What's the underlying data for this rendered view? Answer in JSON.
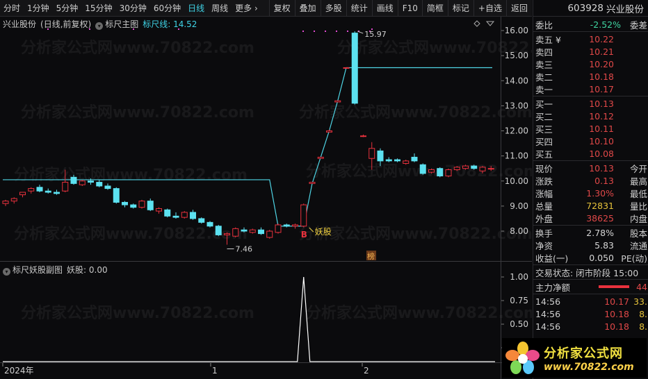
{
  "toolbar": {
    "periods": [
      "分时",
      "1分钟",
      "5分钟",
      "15分钟",
      "30分钟",
      "60分钟",
      "日线",
      "周线",
      "更多 ›"
    ],
    "active_period": "日线",
    "tools": [
      "复权",
      "叠加",
      "多股",
      "统计",
      "画线",
      "F10",
      "简框",
      "标记",
      "+自选",
      "返回"
    ]
  },
  "main_chart": {
    "stock_label": "兴业股份",
    "mode": "(日线,前复权)",
    "indicator_name": "标尺主图",
    "indicator_value_label": "标尺线: 14.52",
    "y_ticks": [
      "16.00",
      "15.00",
      "14.00",
      "13.00",
      "12.00",
      "11.00",
      "10.00",
      "9.00",
      "8.00"
    ],
    "high_label": "15.97",
    "low_label": "7.46",
    "buy_marker": "B",
    "signal_label": "妖股",
    "bang_label": "榜"
  },
  "sub_chart": {
    "indicator_name": "标尺妖股副图",
    "value_label": "妖股: 0.00",
    "y_ticks": [
      "1.00",
      "0.75",
      "0.50",
      "0.25"
    ]
  },
  "x_axis": {
    "labels": [
      "2024年",
      "1",
      "2"
    ]
  },
  "watermark_text": "分析家公式网www.70822.com",
  "chart_data": {
    "type": "candlestick",
    "ylim": [
      7.3,
      16.5
    ],
    "candles": [
      {
        "o": 9.1,
        "h": 9.25,
        "l": 9.0,
        "c": 9.2
      },
      {
        "o": 9.2,
        "h": 9.35,
        "l": 9.1,
        "c": 9.3
      },
      {
        "o": 9.45,
        "h": 9.55,
        "l": 9.35,
        "c": 9.55
      },
      {
        "o": 9.6,
        "h": 9.75,
        "l": 9.5,
        "c": 9.7
      },
      {
        "o": 9.75,
        "h": 9.85,
        "l": 9.55,
        "c": 9.6
      },
      {
        "o": 9.6,
        "h": 9.7,
        "l": 9.5,
        "c": 9.55
      },
      {
        "o": 9.55,
        "h": 9.65,
        "l": 9.45,
        "c": 9.5
      },
      {
        "o": 9.6,
        "h": 10.45,
        "l": 9.55,
        "c": 9.95
      },
      {
        "o": 10.15,
        "h": 10.25,
        "l": 9.85,
        "c": 9.9
      },
      {
        "o": 9.85,
        "h": 10.05,
        "l": 9.8,
        "c": 10.0
      },
      {
        "o": 10.0,
        "h": 10.1,
        "l": 9.85,
        "c": 9.95
      },
      {
        "o": 9.95,
        "h": 10.05,
        "l": 9.75,
        "c": 9.8
      },
      {
        "o": 9.8,
        "h": 9.9,
        "l": 9.65,
        "c": 9.7
      },
      {
        "o": 9.7,
        "h": 9.75,
        "l": 9.1,
        "c": 9.15
      },
      {
        "o": 9.15,
        "h": 9.2,
        "l": 8.95,
        "c": 9.05
      },
      {
        "o": 9.05,
        "h": 9.1,
        "l": 8.9,
        "c": 8.95
      },
      {
        "o": 8.95,
        "h": 9.25,
        "l": 8.9,
        "c": 9.2
      },
      {
        "o": 9.2,
        "h": 9.3,
        "l": 8.8,
        "c": 8.85
      },
      {
        "o": 8.8,
        "h": 8.95,
        "l": 8.7,
        "c": 8.9
      },
      {
        "o": 8.85,
        "h": 8.9,
        "l": 8.55,
        "c": 8.6
      },
      {
        "o": 8.6,
        "h": 8.75,
        "l": 8.5,
        "c": 8.55
      },
      {
        "o": 8.55,
        "h": 8.8,
        "l": 8.5,
        "c": 8.75
      },
      {
        "o": 8.75,
        "h": 8.85,
        "l": 8.45,
        "c": 8.5
      },
      {
        "o": 8.5,
        "h": 8.55,
        "l": 8.3,
        "c": 8.35
      },
      {
        "o": 8.35,
        "h": 8.4,
        "l": 8.15,
        "c": 8.2
      },
      {
        "o": 8.2,
        "h": 8.25,
        "l": 7.8,
        "c": 7.85
      },
      {
        "o": 7.85,
        "h": 7.95,
        "l": 7.46,
        "c": 7.9
      },
      {
        "o": 7.8,
        "h": 8.15,
        "l": 7.75,
        "c": 8.1
      },
      {
        "o": 8.05,
        "h": 8.15,
        "l": 7.95,
        "c": 8.0
      },
      {
        "o": 7.95,
        "h": 8.1,
        "l": 7.9,
        "c": 8.05
      },
      {
        "o": 8.05,
        "h": 8.15,
        "l": 7.85,
        "c": 7.9
      },
      {
        "o": 7.75,
        "h": 8.05,
        "l": 7.7,
        "c": 8.0
      },
      {
        "o": 7.95,
        "h": 8.3,
        "l": 7.9,
        "c": 8.25
      },
      {
        "o": 8.25,
        "h": 8.3,
        "l": 8.15,
        "c": 8.2
      },
      {
        "o": 8.2,
        "h": 8.3,
        "l": 8.1,
        "c": 8.25
      },
      {
        "o": 8.2,
        "h": 9.1,
        "l": 8.15,
        "c": 9.05
      },
      {
        "o": 9.9,
        "h": 9.95,
        "l": 9.9,
        "c": 9.95
      },
      {
        "o": 10.9,
        "h": 10.95,
        "l": 10.9,
        "c": 10.95
      },
      {
        "o": 11.95,
        "h": 12.05,
        "l": 11.95,
        "c": 12.0
      },
      {
        "o": 13.15,
        "h": 13.2,
        "l": 13.15,
        "c": 13.2
      },
      {
        "o": 14.5,
        "h": 14.52,
        "l": 14.5,
        "c": 14.52
      },
      {
        "o": 15.9,
        "h": 15.97,
        "l": 13.05,
        "c": 13.1
      },
      {
        "o": 11.8,
        "h": 11.85,
        "l": 11.75,
        "c": 11.8
      },
      {
        "o": 10.9,
        "h": 11.55,
        "l": 10.45,
        "c": 11.3
      },
      {
        "o": 11.2,
        "h": 11.3,
        "l": 10.6,
        "c": 10.8
      },
      {
        "o": 10.85,
        "h": 10.95,
        "l": 10.75,
        "c": 10.8
      },
      {
        "o": 10.85,
        "h": 10.9,
        "l": 10.75,
        "c": 10.8
      },
      {
        "o": 10.7,
        "h": 10.85,
        "l": 10.65,
        "c": 10.8
      },
      {
        "o": 10.95,
        "h": 11.1,
        "l": 10.75,
        "c": 10.8
      },
      {
        "o": 10.65,
        "h": 10.7,
        "l": 10.25,
        "c": 10.3
      },
      {
        "o": 10.35,
        "h": 10.5,
        "l": 10.3,
        "c": 10.45
      },
      {
        "o": 10.5,
        "h": 10.55,
        "l": 10.15,
        "c": 10.2
      },
      {
        "o": 10.2,
        "h": 10.5,
        "l": 10.15,
        "c": 10.45
      },
      {
        "o": 10.45,
        "h": 10.6,
        "l": 10.4,
        "c": 10.55
      },
      {
        "o": 10.5,
        "h": 10.65,
        "l": 10.45,
        "c": 10.6
      },
      {
        "o": 10.6,
        "h": 10.65,
        "l": 10.45,
        "c": 10.5
      },
      {
        "o": 10.4,
        "h": 10.6,
        "l": 10.3,
        "c": 10.55
      },
      {
        "o": 10.5,
        "h": 10.6,
        "l": 10.4,
        "c": 10.5
      }
    ],
    "ruler_line": [
      10.05,
      10.05,
      10.05,
      10.05,
      10.05,
      10.05,
      10.05,
      10.05,
      10.05,
      10.05,
      10.05,
      10.05,
      10.05,
      10.05,
      10.05,
      10.05,
      10.05,
      10.05,
      10.05,
      10.05,
      10.05,
      10.05,
      10.05,
      10.05,
      10.05,
      10.05,
      10.05,
      10.05,
      10.05,
      10.05,
      10.05,
      10.05,
      8.2,
      8.2,
      8.2,
      8.2,
      9.9,
      10.95,
      12.0,
      13.2,
      14.52,
      14.52,
      14.52,
      14.52,
      14.52,
      14.52,
      14.52,
      14.52,
      14.52,
      14.52,
      14.52,
      14.52,
      14.52,
      14.52,
      14.52,
      14.52,
      14.52,
      14.52
    ],
    "signal_series": [
      0,
      0,
      0,
      0,
      0,
      0,
      0,
      0,
      0,
      0,
      0,
      0,
      0,
      0,
      0,
      0,
      0,
      0,
      0,
      0,
      0,
      0,
      0,
      0,
      0,
      0,
      0,
      0,
      0,
      0,
      0,
      0,
      0,
      0,
      0,
      1,
      0,
      0,
      0,
      0,
      0,
      0,
      0,
      0,
      0,
      0,
      0,
      0,
      0,
      0,
      0,
      0,
      0,
      0,
      0,
      0,
      0,
      0
    ],
    "sub_ylim": [
      0,
      1.05
    ]
  },
  "quote_panel": {
    "code": "603928",
    "name": "兴业股份",
    "weibi_label": "委比",
    "weibi_value": "-2.52%",
    "weicha_label": "委差",
    "asks": [
      {
        "label": "卖五 ¥",
        "price": "10.22"
      },
      {
        "label": "卖四",
        "price": "10.21"
      },
      {
        "label": "卖三",
        "price": "10.20"
      },
      {
        "label": "卖二",
        "price": "10.18"
      },
      {
        "label": "卖一",
        "price": "10.17"
      }
    ],
    "bids": [
      {
        "label": "买一",
        "price": "10.13"
      },
      {
        "label": "买二",
        "price": "10.12"
      },
      {
        "label": "买三",
        "price": "10.11"
      },
      {
        "label": "买四",
        "price": "10.10"
      },
      {
        "label": "买五",
        "price": "10.08"
      }
    ],
    "stats": [
      {
        "k": "现价",
        "v": "10.13",
        "v2": "今开"
      },
      {
        "k": "涨跌",
        "v": "0.13",
        "v2": "最高"
      },
      {
        "k": "涨幅",
        "v": "1.30%",
        "v2": "最低"
      },
      {
        "k": "总量",
        "v": "72831",
        "v2": "量比"
      },
      {
        "k": "外盘",
        "v": "38625",
        "v2": "内盘"
      }
    ],
    "stats2": [
      {
        "k": "换手",
        "v": "2.78%",
        "v2": "股本"
      },
      {
        "k": "净资",
        "v": "5.83",
        "v2": "流通"
      },
      {
        "k": "收益(一)",
        "v": "0.050",
        "v2": "PE(动)"
      }
    ],
    "trade_status": "交易状态: 闭市阶段 15:00",
    "net_flow_label": "主力净额",
    "net_flow_value": "44",
    "ticks": [
      {
        "time": "14:56",
        "price": "10.17",
        "vol": "33."
      },
      {
        "time": "14:56",
        "price": "10.18",
        "vol": "8."
      },
      {
        "time": "14:56",
        "price": "10.18",
        "vol": "8."
      }
    ]
  },
  "logo": {
    "title": "分析家公式网",
    "url": "www.70822.com"
  }
}
